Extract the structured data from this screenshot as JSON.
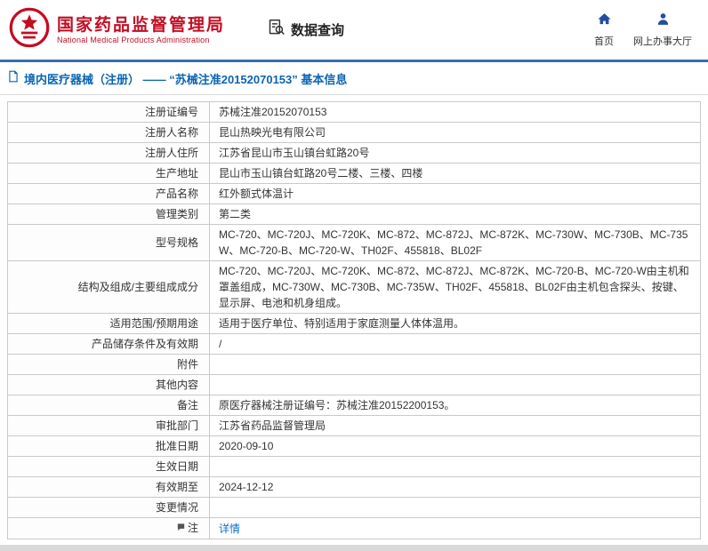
{
  "header": {
    "org_cn": "国家药品监督管理局",
    "org_en": "National Medical Products Administration",
    "data_query": "数据查询",
    "home": "首页",
    "service_hall": "网上办事大厅"
  },
  "breadcrumb": {
    "text": "境内医疗器械（注册） ——  “苏械注准20152070153”  基本信息"
  },
  "table": {
    "rows": [
      {
        "label": "注册证编号",
        "value": "苏械注准20152070153"
      },
      {
        "label": "注册人名称",
        "value": "昆山热映光电有限公司"
      },
      {
        "label": "注册人住所",
        "value": "江苏省昆山市玉山镇台虹路20号"
      },
      {
        "label": "生产地址",
        "value": "昆山市玉山镇台虹路20号二楼、三楼、四楼"
      },
      {
        "label": "产品名称",
        "value": "红外额式体温计"
      },
      {
        "label": "管理类别",
        "value": "第二类"
      },
      {
        "label": "型号规格",
        "value": "MC-720、MC-720J、MC-720K、MC-872、MC-872J、MC-872K、MC-730W、MC-730B、MC-735W、MC-720-B、MC-720-W、TH02F、455818、BL02F"
      },
      {
        "label": "结构及组成/主要组成成分",
        "value": "MC-720、MC-720J、MC-720K、MC-872、MC-872J、MC-872K、MC-720-B、MC-720-W由主机和罩盖组成，MC-730W、MC-730B、MC-735W、TH02F、455818、BL02F由主机包含探头、按键、显示屏、电池和机身组成。"
      },
      {
        "label": "适用范围/预期用途",
        "value": "适用于医疗单位、特别适用于家庭测量人体体温用。"
      },
      {
        "label": "产品储存条件及有效期",
        "value": "/"
      },
      {
        "label": "附件",
        "value": ""
      },
      {
        "label": "其他内容",
        "value": ""
      },
      {
        "label": "备注",
        "value": "原医疗器械注册证编号：苏械注准20152200153。"
      },
      {
        "label": "审批部门",
        "value": "江苏省药品监督管理局"
      },
      {
        "label": "批准日期",
        "value": "2020-09-10"
      },
      {
        "label": "生效日期",
        "value": ""
      },
      {
        "label": "有效期至",
        "value": "2024-12-12"
      },
      {
        "label": "变更情况",
        "value": ""
      },
      {
        "label": "注",
        "value": "详情"
      }
    ]
  },
  "colors": {
    "brand_red": "#c30d23",
    "icon_blue": "#1f4fa0",
    "breadcrumb_blue": "#0a64b4",
    "link_blue": "#0b6fce",
    "header_rule_blue": "#3a6bb5"
  }
}
